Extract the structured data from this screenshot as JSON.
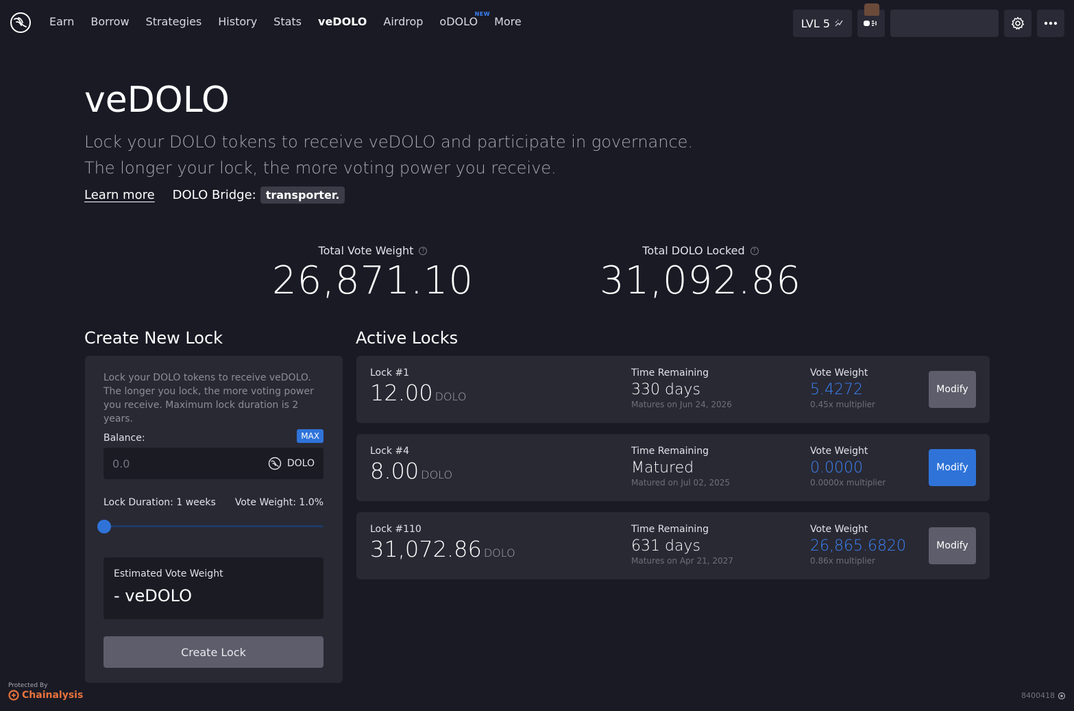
{
  "nav": {
    "items": [
      {
        "label": "Earn",
        "name": "nav-earn"
      },
      {
        "label": "Borrow",
        "name": "nav-borrow"
      },
      {
        "label": "Strategies",
        "name": "nav-strategies"
      },
      {
        "label": "History",
        "name": "nav-history"
      },
      {
        "label": "Stats",
        "name": "nav-stats"
      },
      {
        "label": "veDOLO",
        "name": "nav-vedolo",
        "active": true
      },
      {
        "label": "Airdrop",
        "name": "nav-airdrop"
      },
      {
        "label": "oDOLO",
        "name": "nav-odolo",
        "badge": "NEW"
      },
      {
        "label": "More",
        "name": "nav-more"
      }
    ],
    "level_label": "LVL 5",
    "level_icon": "sparkle-icon",
    "settings_icon": "gear-icon",
    "more_icon": "ellipsis-icon"
  },
  "hero": {
    "title": "veDOLO",
    "subtitle_line1": "Lock your DOLO tokens to receive veDOLO and participate in governance.",
    "subtitle_line2": "The longer your lock, the more voting power you receive.",
    "learn_more": "Learn more",
    "bridge_label": "DOLO Bridge:",
    "bridge_name": "transporter."
  },
  "totals": {
    "vote_weight_label": "Total Vote Weight",
    "vote_weight_value": "26,871.10",
    "dolo_locked_label": "Total DOLO Locked",
    "dolo_locked_value": "31,092.86"
  },
  "create_lock": {
    "title": "Create New Lock",
    "description": "Lock your DOLO tokens to receive veDOLO. The longer you lock, the more voting power you receive. Maximum lock duration is 2 years.",
    "balance_label": "Balance:",
    "max_label": "MAX",
    "amount_placeholder": "0.0",
    "token": "DOLO",
    "duration_label": "Lock Duration: 1 weeks",
    "vote_weight_label": "Vote Weight: 1.0%",
    "slider_fraction": 0.0,
    "estimated_label": "Estimated Vote Weight",
    "estimated_value": "- veDOLO",
    "button": "Create Lock"
  },
  "active_locks": {
    "title": "Active Locks",
    "time_label": "Time Remaining",
    "weight_label": "Vote Weight",
    "unit": "DOLO",
    "modify_label": "Modify",
    "locks": [
      {
        "id": "Lock #1",
        "amount": "12.00",
        "time": "330 days",
        "date": "Matures on Jun 24, 2026",
        "weight": "5.4272",
        "multiplier": "0.45x multiplier",
        "primary": false
      },
      {
        "id": "Lock #4",
        "amount": "8.00",
        "time": "Matured",
        "date": "Matured on Jul 02, 2025",
        "weight": "0.0000",
        "multiplier": "0.0000x multiplier",
        "primary": true
      },
      {
        "id": "Lock #110",
        "amount": "31,072.86",
        "time": "631 days",
        "date": "Matures on Apr 21, 2027",
        "weight": "26,865.6820",
        "multiplier": "0.86x multiplier",
        "primary": false
      }
    ]
  },
  "footer": {
    "protected_by": "Protected By",
    "brand": "Chainalysis",
    "build": "8400418"
  },
  "colors": {
    "background": "#1a1a25",
    "card": "#292934",
    "accent": "#2f73d9",
    "weight_blue": "#3b82f6",
    "chainalysis": "#e8733c"
  }
}
